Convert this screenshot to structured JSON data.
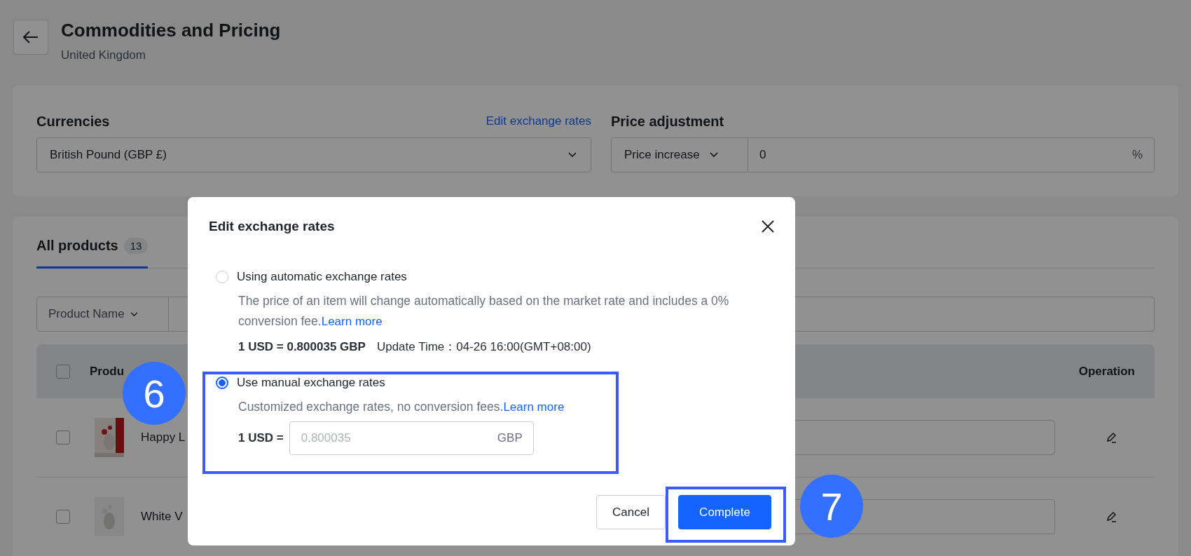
{
  "page": {
    "title": "Commodities and Pricing",
    "subtitle": "United Kingdom"
  },
  "settings": {
    "currencies_label": "Currencies",
    "edit_link": "Edit exchange rates",
    "currency_value": "British Pound (GBP £)",
    "price_adjustment_label": "Price adjustment",
    "adjustment_type": "Price increase",
    "adjustment_value": "0",
    "adjustment_unit": "%"
  },
  "products": {
    "tabs": [
      {
        "label": "All products",
        "count": "13",
        "selected": true
      }
    ],
    "filter_label": "Product Name",
    "table": {
      "header_checked": false,
      "columns": [
        "Produ",
        "Operation"
      ],
      "rows": [
        {
          "name": "Happy L",
          "checked": false
        },
        {
          "name": "White V",
          "checked": false
        }
      ]
    }
  },
  "modal": {
    "title": "Edit exchange rates",
    "options": [
      {
        "kind": "auto",
        "label": "Using automatic exchange rates",
        "description": "The price of an item will change automatically based on the market rate and includes a 0% conversion fee.",
        "link": "Learn more",
        "rate": "1 USD = 0.800035 GBP",
        "update_time": "Update Time：04-26 16:00(GMT+08:00)",
        "selected": false
      },
      {
        "kind": "manual",
        "label": "Use manual exchange rates",
        "description": "Customized exchange rates, no conversion fees.",
        "link": "Learn more",
        "input_label": "1 USD =",
        "placeholder": "0.800035",
        "unit": "GBP",
        "selected": true
      }
    ],
    "buttons": [
      {
        "label": "Cancel",
        "kind": "secondary"
      },
      {
        "label": "Complete",
        "kind": "primary"
      }
    ]
  },
  "callouts": [
    {
      "number": "6"
    },
    {
      "number": "7"
    }
  ]
}
